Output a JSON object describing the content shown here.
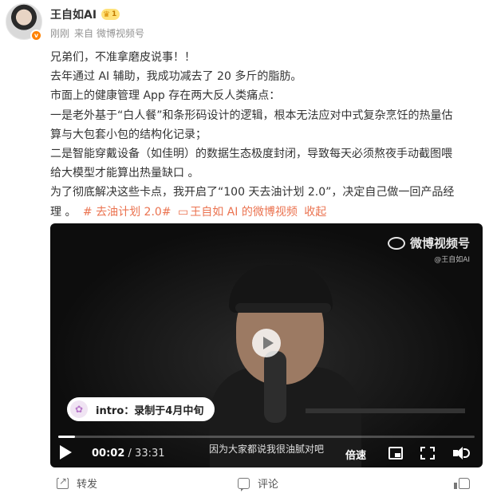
{
  "header": {
    "user_name": "王自如AI",
    "level_badge": "1",
    "verified_mark": "v",
    "time": "刚刚",
    "source_prefix": "来自",
    "source": "微博视频号"
  },
  "post": {
    "lines": [
      "兄弟们，不准拿磨皮说事！！",
      "去年通过 AI 辅助，我成功减去了 20 多斤的脂肪。",
      "市面上的健康管理 App 存在两大反人类痛点：",
      "一是老外基于“白人餐”和条形码设计的逻辑，根本无法应对中式复杂烹饪的热量估",
      "算与大包套小包的结构化记录；",
      "二是智能穿戴设备（如佳明）的数据生态极度封闭，导致每天必须熬夜手动截图喂",
      "给大模型才能算出热量缺口 。",
      "为了彻底解决这些卡点，我开启了“100 天去油计划 2.0”，决定自己做一回产品经"
    ],
    "last_line_prefix": "理 。",
    "hashtag": "# 去油计划 2.0#",
    "video_link": "王自如 AI 的微博视频",
    "collapse": "收起"
  },
  "video": {
    "watermark_title": "微博视频号",
    "watermark_handle": "@王自如AI",
    "intro_label": "intro：录制于4月中旬",
    "subtitle": "因为大家都说我很油腻对吧",
    "current_time": "00:02",
    "separator": " / ",
    "total_time": "33:31",
    "speed_label": "倍速",
    "progress_fraction": 0.04
  },
  "footer": {
    "forward": "转发",
    "comment": "评论"
  },
  "colors": {
    "accent_orange": "#eb7350",
    "verified": "#ff8200"
  },
  "icons": [
    "play-icon",
    "pip-icon",
    "fullscreen-icon",
    "volume-icon",
    "forward-icon",
    "comment-icon",
    "like-icon",
    "video-link-icon"
  ]
}
